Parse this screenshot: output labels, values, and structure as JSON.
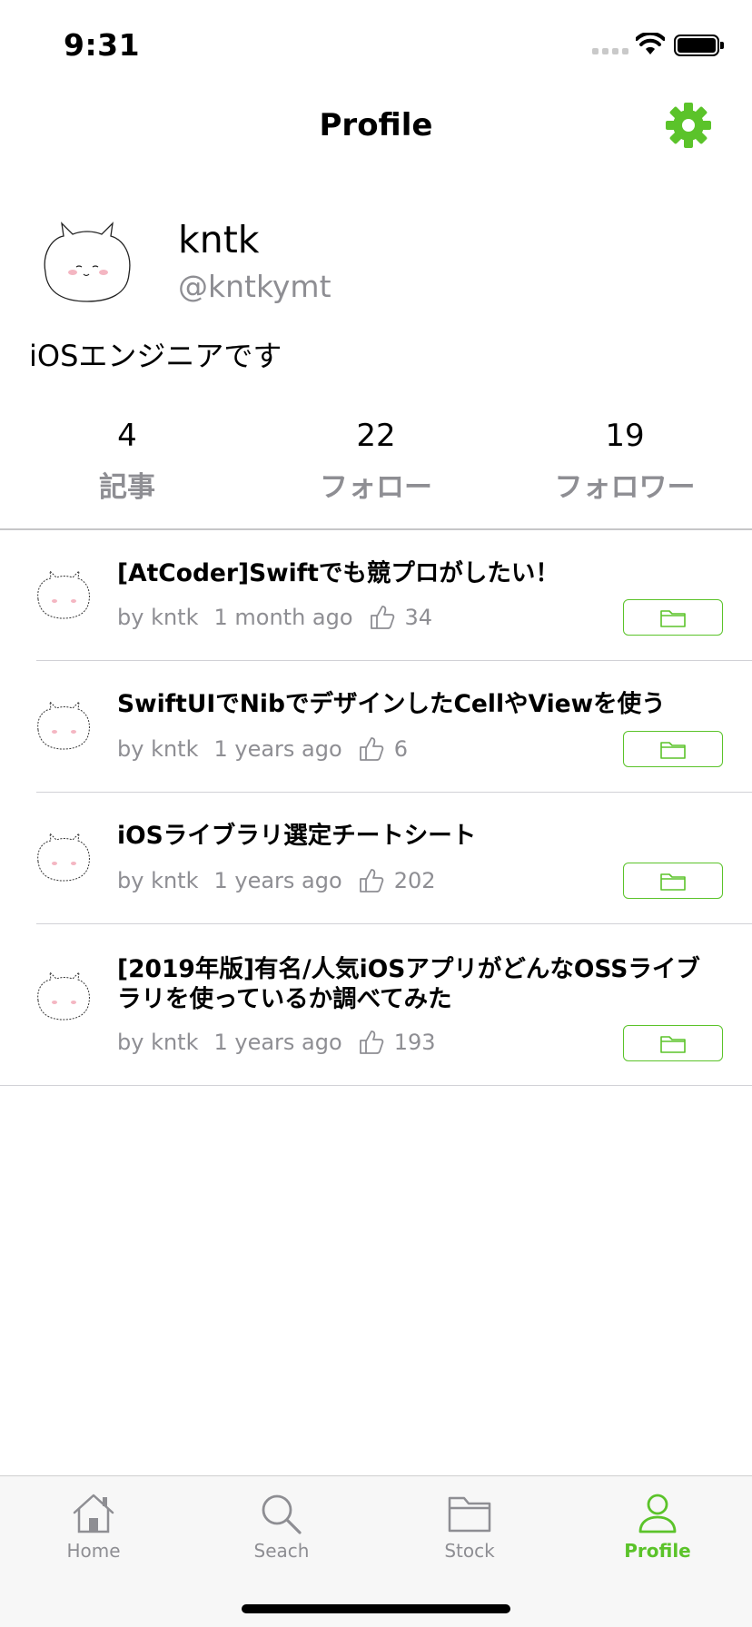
{
  "status_bar": {
    "time": "9:31"
  },
  "nav": {
    "title": "Profile",
    "settings_icon": "gear-icon"
  },
  "profile": {
    "name": "kntk",
    "handle": "@kntkymt",
    "bio": "iOSエンジニアです",
    "stats": [
      {
        "count": "4",
        "label": "記事"
      },
      {
        "count": "22",
        "label": "フォロー"
      },
      {
        "count": "19",
        "label": "フォロワー"
      }
    ]
  },
  "articles": [
    {
      "title": "[AtCoder]Swiftでも競プロがしたい！",
      "author": "by kntk",
      "time": "1 month ago",
      "likes": "34"
    },
    {
      "title": "SwiftUIでNibでデザインしたCellやViewを使う",
      "author": "by kntk",
      "time": "1 years ago",
      "likes": "6"
    },
    {
      "title": "iOSライブラリ選定チートシート",
      "author": "by kntk",
      "time": "1 years ago",
      "likes": "202"
    },
    {
      "title": "[2019年版]有名/人気iOSアプリがどんなOSSライブラリを使っているか調べてみた",
      "author": "by kntk",
      "time": "1 years ago",
      "likes": "193"
    }
  ],
  "tabs": [
    {
      "label": "Home",
      "icon": "house-icon"
    },
    {
      "label": "Seach",
      "icon": "magnifier-icon"
    },
    {
      "label": "Stock",
      "icon": "folder-icon"
    },
    {
      "label": "Profile",
      "icon": "person-icon",
      "active": true
    }
  ],
  "colors": {
    "accent": "#5bc32a",
    "secondary_text": "#8e8e93"
  }
}
